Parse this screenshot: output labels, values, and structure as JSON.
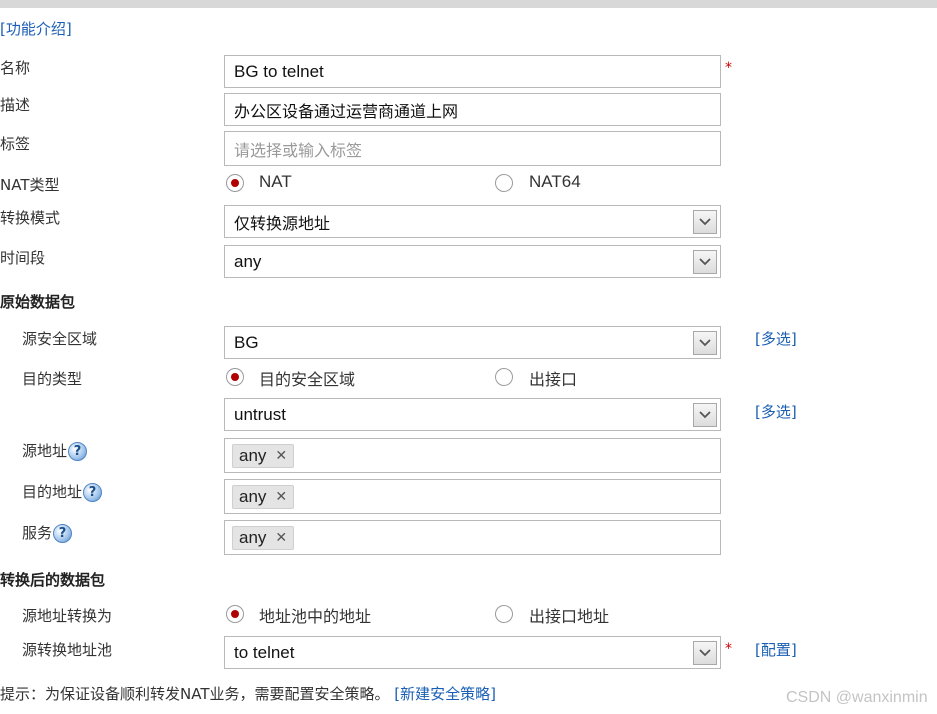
{
  "intro_link": "[功能介绍]",
  "fields": {
    "name": {
      "label": "名称",
      "value": "BG to telnet",
      "required": "*"
    },
    "desc": {
      "label": "描述",
      "value": "办公区设备通过运营商通道上网"
    },
    "tag": {
      "label": "标签",
      "placeholder": "请选择或输入标签"
    },
    "nat_type": {
      "label": "NAT类型",
      "options": [
        "NAT",
        "NAT64"
      ],
      "selected": "NAT"
    },
    "mode": {
      "label": "转换模式",
      "value": "仅转换源地址"
    },
    "time": {
      "label": "时间段",
      "value": "any"
    }
  },
  "original_packet": {
    "heading": "原始数据包",
    "src_zone": {
      "label": "源安全区域",
      "value": "BG",
      "multi": "[多选]"
    },
    "dst_type": {
      "label": "目的类型",
      "options": [
        "目的安全区域",
        "出接口"
      ],
      "selected": "目的安全区域"
    },
    "dst_zone": {
      "value": "untrust",
      "multi": "[多选]"
    },
    "src_addr": {
      "label": "源地址",
      "tag": "any"
    },
    "dst_addr": {
      "label": "目的地址",
      "tag": "any"
    },
    "service": {
      "label": "服务",
      "tag": "any"
    }
  },
  "translated_packet": {
    "heading": "转换后的数据包",
    "src_translate": {
      "label": "源地址转换为",
      "options": [
        "地址池中的地址",
        "出接口地址"
      ],
      "selected": "地址池中的地址"
    },
    "pool": {
      "label": "源转换地址池",
      "value": "to telnet",
      "required": "*",
      "config": "[配置]"
    }
  },
  "footer": {
    "tip": "提示：为保证设备顺利转发NAT业务，需要配置安全策略。",
    "link": "[新建安全策略]"
  },
  "help_glyph": "?",
  "remove_glyph": "✕",
  "watermark": "CSDN @wanxinmin",
  "colors": {
    "link": "#1a5fb4",
    "required": "#d00000",
    "radio_selected": "#b00000"
  }
}
